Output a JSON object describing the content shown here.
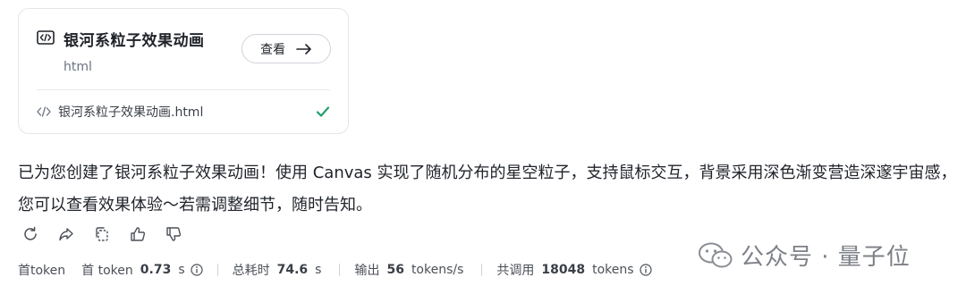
{
  "card": {
    "title": "银河系粒子效果动画",
    "subtitle": "html",
    "view_label": "查看",
    "file_name": "银河系粒子效果动画.html"
  },
  "message": {
    "text": "已为您创建了银河系粒子效果动画！使用 Canvas 实现了随机分布的星空粒子，支持鼠标交互，背景采用深色渐变营造深邃宇宙感，您可以查看效果体验～若需调整细节，随时告知。"
  },
  "stats": {
    "first_token_label": "首token",
    "first_token_time_label": "首 token",
    "first_token_time_value": "0.73",
    "first_token_time_unit": "s",
    "total_time_label": "总耗时",
    "total_time_value": "74.6",
    "total_time_unit": "s",
    "output_label": "输出",
    "output_value": "56",
    "output_unit": "tokens/s",
    "calls_label": "共调用",
    "calls_value": "18048",
    "calls_unit": "tokens"
  },
  "watermark": {
    "text": "公众号 · 量子位"
  },
  "colors": {
    "accent_check": "#22a06b",
    "border": "#e3e5ea"
  },
  "icons": [
    "code-window-icon",
    "arrow-right-icon",
    "code-icon",
    "check-icon",
    "refresh-icon",
    "share-icon",
    "copy-icon",
    "thumbs-up-icon",
    "thumbs-down-icon",
    "info-icon",
    "wechat-icon"
  ]
}
